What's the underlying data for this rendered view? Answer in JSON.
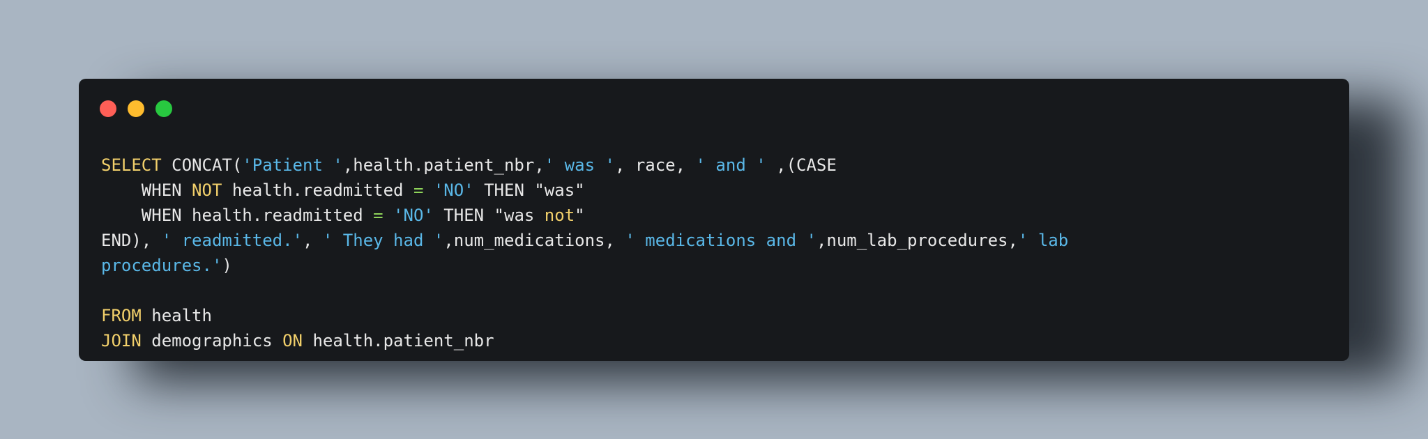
{
  "window": {
    "controls": [
      "close-button",
      "minimize-button",
      "maximize-button"
    ],
    "colors": {
      "background": "#17191c",
      "close": "#ff5f57",
      "minimize": "#febc2e",
      "maximize": "#28c840",
      "keyword": "#f2d06b",
      "string": "#5ab8e8",
      "operator": "#8fd45a",
      "text": "#e8e8e8"
    }
  },
  "code": {
    "line1": {
      "t0": "SELECT",
      "t1": " CONCAT(",
      "t2": "'Patient '",
      "t3": ",health.patient_nbr,",
      "t4": "' was '",
      "t5": ", race, ",
      "t6": "' and '",
      "t7": " ,(CASE"
    },
    "line2": {
      "t0": "    WHEN ",
      "t1": "NOT",
      "t2": " health.readmitted ",
      "t3": "=",
      "t4": " ",
      "t5": "'NO'",
      "t6": " THEN \"was\""
    },
    "line3": {
      "t0": "    WHEN health.readmitted ",
      "t1": "=",
      "t2": " ",
      "t3": "'NO'",
      "t4": " THEN \"was ",
      "t5": "not",
      "t6": "\""
    },
    "line4": {
      "t0": "END), ",
      "t1": "' readmitted.'",
      "t2": ", ",
      "t3": "' They had '",
      "t4": ",num_medications, ",
      "t5": "' medications and '",
      "t6": ",num_lab_procedures,",
      "t7": "' lab"
    },
    "line5": {
      "t0": "procedures.'",
      "t1": ")"
    },
    "line6": {
      "t0": "FROM",
      "t1": " health"
    },
    "line7": {
      "t0": "JOIN",
      "t1": " demographics ",
      "t2": "ON",
      "t3": " health.patient_nbr"
    }
  }
}
